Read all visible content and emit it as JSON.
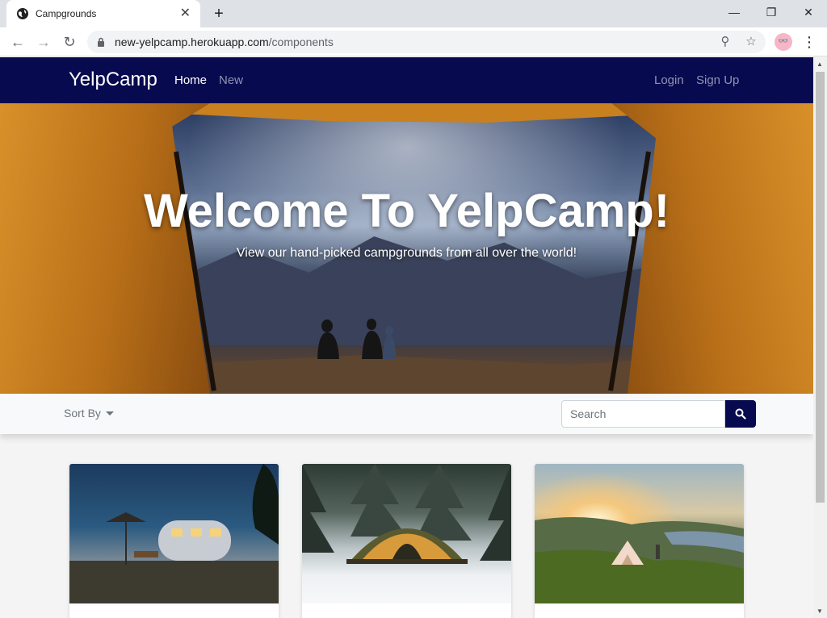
{
  "browser": {
    "tab_title": "Campgrounds",
    "url_host": "new-yelpcamp.herokuapp.com",
    "url_path": "/components",
    "new_tab_symbol": "+",
    "close_symbol": "✕"
  },
  "navbar": {
    "brand": "YelpCamp",
    "links": [
      {
        "label": "Home",
        "active": true
      },
      {
        "label": "New",
        "active": false
      }
    ],
    "right_links": [
      {
        "label": "Login"
      },
      {
        "label": "Sign Up"
      }
    ],
    "background": "#070a4f"
  },
  "hero": {
    "title": "Welcome To YelpCamp!",
    "subtitle": "View our hand-picked campgrounds from all over the world!"
  },
  "filters": {
    "sort_label": "Sort By",
    "search_placeholder": "Search"
  },
  "cards": [
    {
      "image": "vintage-trailer-campsite-photo"
    },
    {
      "image": "snowy-forest-tent-photo"
    },
    {
      "image": "mountain-sunset-tent-photo"
    }
  ]
}
